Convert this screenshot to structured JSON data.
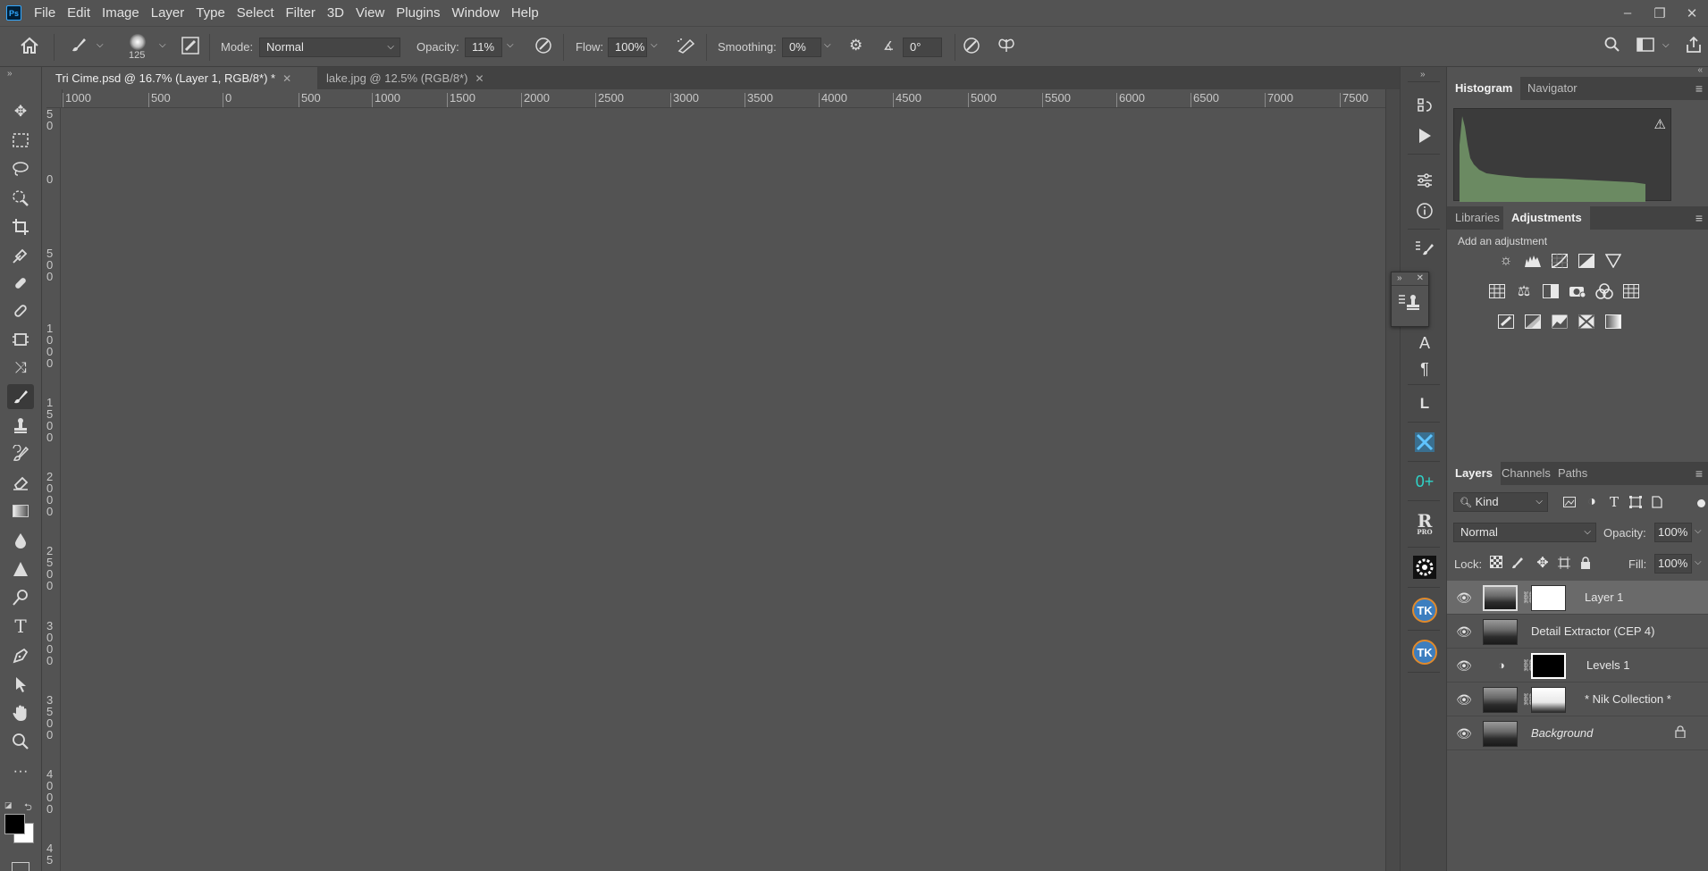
{
  "menu": [
    "File",
    "Edit",
    "Image",
    "Layer",
    "Type",
    "Select",
    "Filter",
    "3D",
    "View",
    "Plugins",
    "Window",
    "Help"
  ],
  "app_logo": "Ps",
  "window_controls": {
    "minimize": "–",
    "restore": "❐",
    "close": "✕"
  },
  "options": {
    "brush_size": "125",
    "mode_label": "Mode:",
    "mode_value": "Normal",
    "opacity_label": "Opacity:",
    "opacity_value": "11%",
    "flow_label": "Flow:",
    "flow_value": "100%",
    "smoothing_label": "Smoothing:",
    "smoothing_value": "0%",
    "angle_value": "0°"
  },
  "tabs": [
    {
      "label": "Tri Cime.psd @ 16.7% (Layer 1, RGB/8*) *"
    },
    {
      "label": "lake.jpg @ 12.5% (RGB/8*)"
    }
  ],
  "hruler_labels": [
    "1000",
    "500",
    "0",
    "500",
    "1000",
    "1500",
    "2000",
    "2500",
    "3000",
    "3500",
    "4000",
    "4500",
    "5000",
    "5500",
    "6000",
    "6500",
    "7000",
    "7500"
  ],
  "vruler_labels": [
    "5\n0",
    "0",
    "5\n0\n0",
    "1\n0\n0\n0",
    "1\n5\n0\n0",
    "2\n0\n0\n0",
    "2\n5\n0\n0",
    "3\n0\n0\n0",
    "3\n5\n0\n0",
    "4\n0\n0\n0",
    "4\n5"
  ],
  "right_panels": {
    "histogram_tabs": [
      "Histogram",
      "Navigator"
    ],
    "adjust_tabs": [
      "Libraries",
      "Adjustments"
    ],
    "add_adjustment": "Add an adjustment",
    "layers_tabs": [
      "Layers",
      "Channels",
      "Paths"
    ],
    "kind_filter": "Kind",
    "blend_mode": "Normal",
    "opacity_label": "Opacity:",
    "opacity_value": "100%",
    "lock_label": "Lock:",
    "fill_label": "Fill:",
    "fill_value": "100%"
  },
  "layers": [
    {
      "name": "Layer 1",
      "selected": true
    },
    {
      "name": "Detail Extractor  (CEP 4)"
    },
    {
      "name": "Levels 1"
    },
    {
      "name": "* Nik Collection *"
    },
    {
      "name": "Background"
    }
  ],
  "colors": {
    "accent": "#31a8ff",
    "panel_bg": "#535353",
    "dark_bg": "#424242",
    "histogram": "#6b8a62"
  }
}
